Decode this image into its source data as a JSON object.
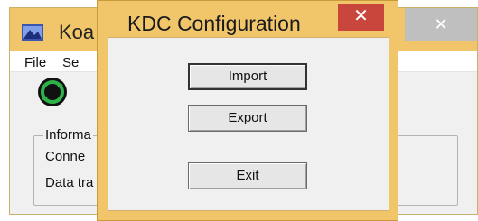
{
  "background_window": {
    "title": "Koa",
    "close_glyph": "✕",
    "menu": [
      {
        "label": "File"
      },
      {
        "label": "Se"
      }
    ],
    "group": {
      "legend": "Informa",
      "line1": "Conne",
      "line2": "Data tra"
    },
    "icons": {
      "app": "app-icon",
      "status": "sync-icon"
    }
  },
  "dialog": {
    "title": "KDC Configuration",
    "close_glyph": "✕",
    "buttons": {
      "import": "Import",
      "export": "Export",
      "exit": "Exit"
    }
  },
  "colors": {
    "title_bar": "#f1c66b",
    "close_red": "#c9463d",
    "inactive_close": "#bfbfbf",
    "sync_green": "#2eb34b"
  }
}
